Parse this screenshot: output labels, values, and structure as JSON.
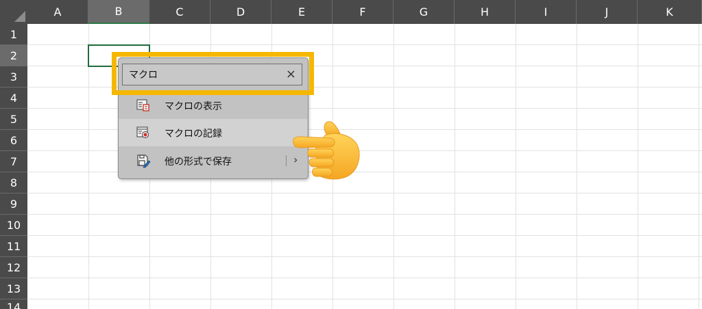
{
  "columns": [
    "A",
    "B",
    "C",
    "D",
    "E",
    "F",
    "G",
    "H",
    "I",
    "J",
    "K"
  ],
  "rows": [
    "1",
    "2",
    "3",
    "4",
    "5",
    "6",
    "7",
    "8",
    "9",
    "10",
    "11",
    "12",
    "13",
    "14"
  ],
  "selected_cell": {
    "column": "B",
    "row": "2"
  },
  "colors": {
    "header_bg": "#4a4a4a",
    "header_selected": "#6b6b6b",
    "active_border": "#1e6b3a",
    "highlight": "#f5b700",
    "menu_bg": "#c2c2c2"
  },
  "search": {
    "value": "マクロ",
    "clear_icon": "×"
  },
  "menu_items": [
    {
      "label": "マクロの表示",
      "icon": "view-macros-icon"
    },
    {
      "label": "マクロの記録",
      "icon": "record-macro-icon"
    },
    {
      "label": "他の形式で保存",
      "icon": "save-as-icon",
      "submenu": "›"
    }
  ]
}
